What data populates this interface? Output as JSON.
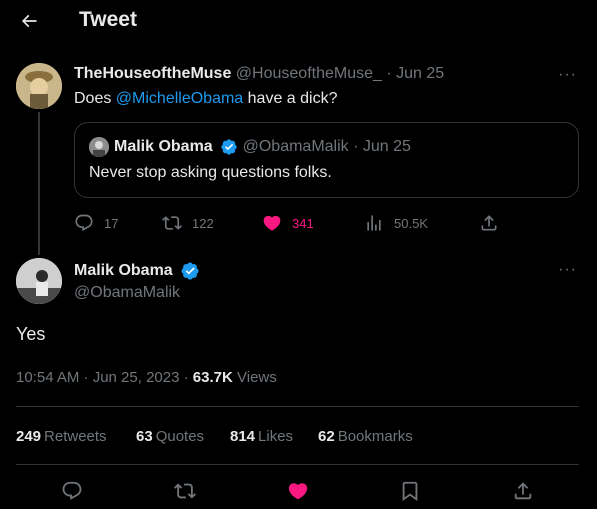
{
  "header": {
    "title": "Tweet",
    "back_icon": "arrow-left-icon"
  },
  "reply_tweet": {
    "display_name": "TheHouseoftheMuse",
    "handle": "@HouseoftheMuse_",
    "date": "· Jun 25",
    "text_prefix": "Does ",
    "mention": "@MichelleObama",
    "text_suffix": " have a dick?",
    "more": "···",
    "quote": {
      "display_name": "Malik Obama",
      "handle": "@ObamaMalik",
      "date": "· Jun 25",
      "text": "Never stop asking questions folks."
    },
    "actions": {
      "replies": "17",
      "retweets": "122",
      "likes": "341",
      "views": "50.5K"
    }
  },
  "main_tweet": {
    "display_name": "Malik Obama",
    "handle": "@ObamaMalik",
    "more": "···",
    "text": "Yes",
    "timestamp": "10:54 AM · Jun 25, 2023 ·",
    "views_count": "63.7K",
    "views_label": "Views"
  },
  "stats": {
    "retweets_count": "249",
    "retweets_label": "Retweets",
    "quotes_count": "63",
    "quotes_label": "Quotes",
    "likes_count": "814",
    "likes_label": "Likes",
    "bookmarks_count": "62",
    "bookmarks_label": "Bookmarks"
  },
  "colors": {
    "background": "#000000",
    "text": "#e7e9ea",
    "muted": "#71767b",
    "mention": "#1d9bf0",
    "like": "#f91880",
    "verified": "#1d9bf0"
  }
}
